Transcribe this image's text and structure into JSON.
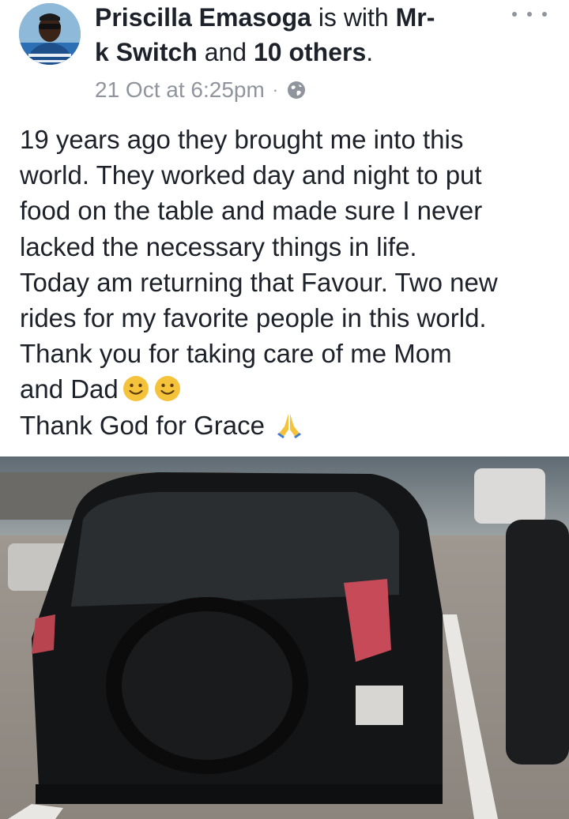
{
  "post": {
    "author": "Priscilla Emasoga",
    "with_text": "is with",
    "tagged_name": "Mr-k Switch",
    "tagged_line1": "Mr-",
    "tagged_line2": "k Switch",
    "and_text": "and",
    "others": "10 others",
    "period": ".",
    "timestamp": "21 Oct at 6:25pm",
    "separator": "·",
    "privacy_icon": "globe-icon",
    "more_icon": "more-options-icon",
    "text_lines": [
      "19 years ago they brought me into this",
      "world. They worked day and night to put",
      "food on the table and made sure I never",
      "lacked the necessary things in life.",
      "Today am returning that Favour. Two new",
      "rides for my favorite people in this world.",
      "Thank you for taking care of me Mom",
      "and Dad",
      "Thank God for Grace"
    ],
    "emojis": [
      "slightly-smiling-face-icon",
      "slightly-smiling-face-icon",
      "folded-hands-icon"
    ],
    "photo": "black-suv-parking-lot-photo"
  },
  "colors": {
    "text": "#1d2129",
    "meta": "#90949c",
    "emoji_yellow": "#f5c33b"
  }
}
